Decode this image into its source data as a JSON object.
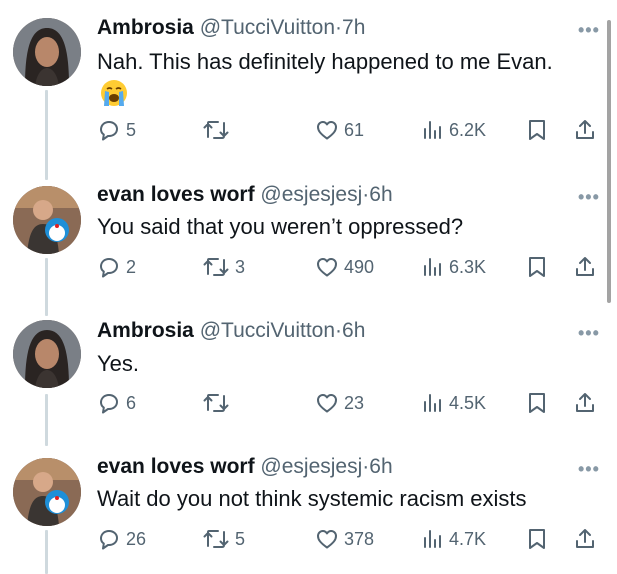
{
  "tweets": [
    {
      "display_name": "Ambrosia",
      "handle": "@TucciVuitton",
      "separator": "·",
      "time": "7h",
      "text": "Nah. This has definitely happened to me Evan.",
      "emoji": "😭",
      "replies": "5",
      "retweets": "",
      "likes": "61",
      "views": "6.2K",
      "avatar": "woman-portrait"
    },
    {
      "display_name": "evan loves worf",
      "handle": "@esjesjesj",
      "separator": "·",
      "time": "6h",
      "text": "You said that you weren’t oppressed?",
      "replies": "2",
      "retweets": "3",
      "likes": "490",
      "views": "6.3K",
      "avatar": "man-with-doraemon"
    },
    {
      "display_name": "Ambrosia",
      "handle": "@TucciVuitton",
      "separator": "·",
      "time": "6h",
      "text": "Yes.",
      "replies": "6",
      "retweets": "",
      "likes": "23",
      "views": "4.5K",
      "avatar": "woman-portrait"
    },
    {
      "display_name": "evan loves worf",
      "handle": "@esjesjesj",
      "separator": "·",
      "time": "6h",
      "text": "Wait do you not think systemic racism exists",
      "replies": "26",
      "retweets": "5",
      "likes": "378",
      "views": "4.7K",
      "avatar": "man-with-doraemon"
    }
  ],
  "more_glyph": "•••",
  "colors": {
    "text": "#0f1419",
    "secondary": "#536471",
    "thread_line": "#cfd9de"
  }
}
